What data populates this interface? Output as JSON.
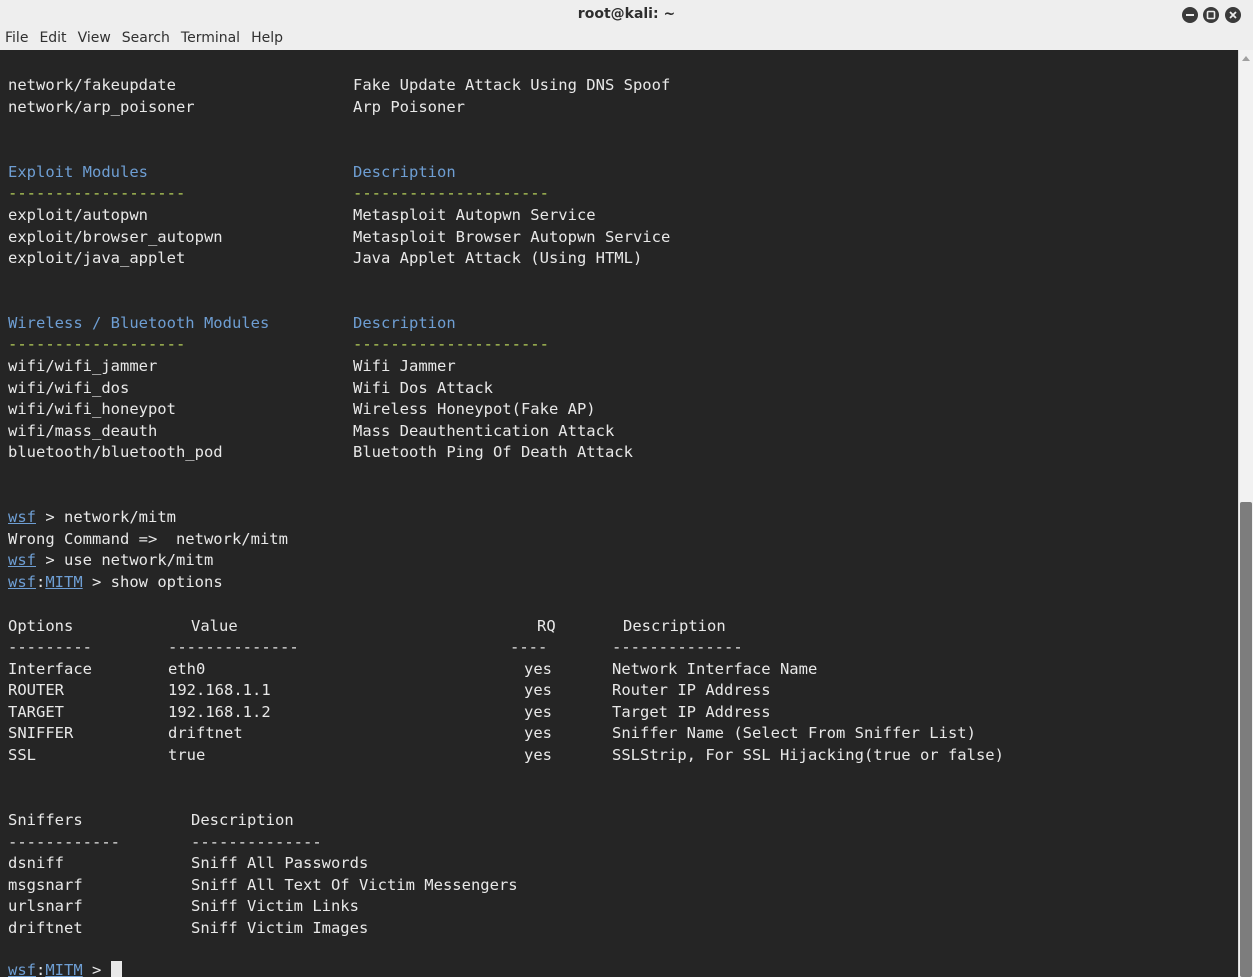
{
  "window": {
    "title": "root@kali: ~",
    "menu": [
      "File",
      "Edit",
      "View",
      "Search",
      "Terminal",
      "Help"
    ]
  },
  "network_rows": [
    {
      "module": "network/fakeupdate",
      "desc": "Fake Update Attack Using DNS Spoof"
    },
    {
      "module": "network/arp_poisoner",
      "desc": "Arp Poisoner"
    }
  ],
  "exploit": {
    "header": "Exploit Modules",
    "desc_header": "Description",
    "dash_a": "-------------------",
    "dash_b": "---------------------",
    "rows": [
      {
        "module": "exploit/autopwn",
        "desc": "Metasploit Autopwn Service"
      },
      {
        "module": "exploit/browser_autopwn",
        "desc": "Metasploit Browser Autopwn Service"
      },
      {
        "module": "exploit/java_applet",
        "desc": "Java Applet Attack (Using HTML)"
      }
    ]
  },
  "wireless": {
    "header": "Wireless / Bluetooth Modules",
    "desc_header": "Description",
    "dash_a": "-------------------",
    "dash_b": "---------------------",
    "rows": [
      {
        "module": "wifi/wifi_jammer",
        "desc": "Wifi Jammer"
      },
      {
        "module": "wifi/wifi_dos",
        "desc": "Wifi Dos Attack"
      },
      {
        "module": "wifi/wifi_honeypot",
        "desc": "Wireless Honeypot(Fake AP)"
      },
      {
        "module": "wifi/mass_deauth",
        "desc": "Mass Deauthentication Attack"
      },
      {
        "module": "bluetooth/bluetooth_pod",
        "desc": "Bluetooth Ping Of Death Attack"
      }
    ]
  },
  "session": {
    "prompt_wsf": "wsf",
    "prompt_sep": " > ",
    "cmd1": "network/mitm",
    "error": "Wrong Command =>  network/mitm",
    "cmd2": "use network/mitm",
    "prompt_mitm": "MITM",
    "prompt_colon": ":",
    "cmd3": "show options"
  },
  "options_table": {
    "headers": [
      "Options",
      "Value",
      "RQ",
      "Description"
    ],
    "dashes": [
      "---------",
      "--------------",
      "----",
      "--------------"
    ],
    "rows": [
      {
        "option": "Interface",
        "value": "eth0",
        "rq": "yes",
        "desc": "Network Interface Name"
      },
      {
        "option": "ROUTER",
        "value": "192.168.1.1",
        "rq": "yes",
        "desc": "Router IP Address"
      },
      {
        "option": "TARGET",
        "value": "192.168.1.2",
        "rq": "yes",
        "desc": "Target IP Address"
      },
      {
        "option": "SNIFFER",
        "value": "driftnet",
        "rq": "yes",
        "desc": "Sniffer Name (Select From Sniffer List)"
      },
      {
        "option": "SSL",
        "value": "true",
        "rq": "yes",
        "desc": "SSLStrip, For SSL Hijacking(true or false)"
      }
    ]
  },
  "sniffers_table": {
    "headers": [
      "Sniffers",
      "Description"
    ],
    "dashes": [
      "------------",
      "--------------"
    ],
    "rows": [
      {
        "name": "dsniff",
        "desc": "Sniff All Passwords"
      },
      {
        "name": "msgsnarf",
        "desc": "Sniff All Text Of Victim Messengers"
      },
      {
        "name": "urlsnarf",
        "desc": "Sniff Victim Links"
      },
      {
        "name": "driftnet",
        "desc": "Sniff Victim Images"
      }
    ]
  },
  "final_prompt": {
    "wsf": "wsf",
    "colon": ":",
    "mitm": "MITM",
    "sep": " > "
  },
  "colors": {
    "background": "#252525",
    "text": "#e8e8e8",
    "header": "#6e9ed3",
    "dashes": "#b9d45a"
  }
}
